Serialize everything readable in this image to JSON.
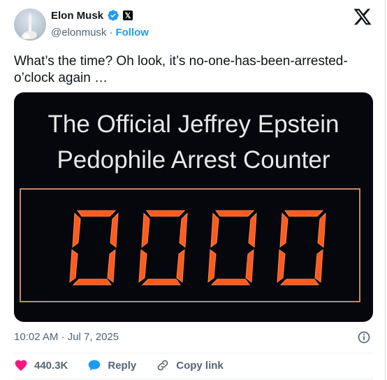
{
  "author": {
    "name": "Elon Musk",
    "handle": "@elonmusk",
    "separator": "·",
    "follow_label": "Follow",
    "x_badge": "𝕏"
  },
  "tweet": {
    "text": "What’s the time? Oh look, it’s no-one-has-been-arrested-o’clock again …",
    "timestamp": "10:02 AM · Jul 7, 2025"
  },
  "media": {
    "title_line1": "The Official Jeffrey Epstein",
    "title_line2": "Pedophile Arrest Counter",
    "counter_digits": [
      "0",
      "0",
      "0",
      "0"
    ],
    "digit_color": "#ff5a1f"
  },
  "actions": {
    "likes": "440.3K",
    "reply_label": "Reply",
    "copy_link_label": "Copy link"
  },
  "colors": {
    "accent": "#1d9bf0",
    "like": "#f91880",
    "muted": "#536471"
  }
}
